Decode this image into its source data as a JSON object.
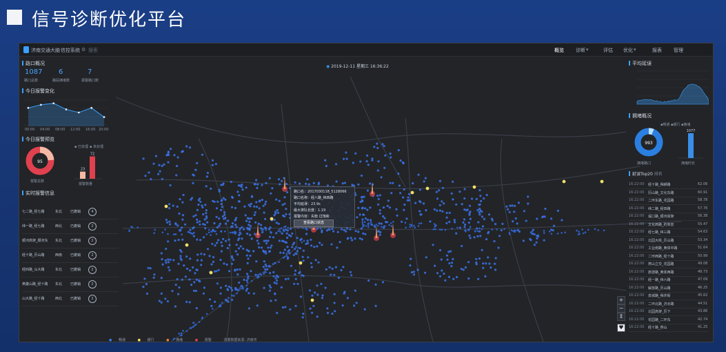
{
  "slide": {
    "title": "信号诊断优化平台"
  },
  "app": {
    "brand": "济南交通大脑",
    "subsystem": "信控系统",
    "search_placeholder": "搜索",
    "nav": [
      "概览",
      "诊断",
      "评估",
      "优化",
      "报表",
      "管理"
    ],
    "datetime": "2019-12-11 星期三 16:36:22"
  },
  "left": {
    "crossing_overview": {
      "title": "路口概况",
      "stats": [
        {
          "value": "1087",
          "label": "路口总数"
        },
        {
          "value": "6",
          "label": "路段拥堵数"
        },
        {
          "value": "7",
          "label": "报警路口数"
        }
      ]
    },
    "alarm_change": {
      "title": "今日报警变化",
      "values": [
        12,
        14,
        15,
        11,
        9,
        12,
        6
      ],
      "xlabels": [
        "00:00",
        "04:00",
        "08:00",
        "12:00",
        "16:00",
        "20:00"
      ]
    },
    "alarm_preview": {
      "title": "今日报警预览",
      "donut_label": "报警总数",
      "donut_value": "95",
      "bar_legend": [
        "已处理",
        "未处理"
      ],
      "bar_values": [
        23,
        72
      ],
      "bar_caption": "报警数量"
    },
    "alarm_info": {
      "title": "实时报警信息",
      "rows": [
        {
          "name": "七二路_经七路",
          "dir": "东北",
          "status": "已撤销",
          "n": "4"
        },
        {
          "name": "纬一路_经七路",
          "dir": "西北",
          "status": "已撤销",
          "n": "2"
        },
        {
          "name": "顺河高架_顺河东",
          "dir": "东北",
          "status": "已撤销",
          "n": "2"
        },
        {
          "name": "经十路_历山路",
          "dir": "西南",
          "status": "已撤销",
          "n": "2"
        },
        {
          "name": "经四路_山大路",
          "dir": "东北",
          "status": "已撤销",
          "n": "2"
        },
        {
          "name": "英雄山路_经十路",
          "dir": "东北",
          "status": "已撤销",
          "n": "2"
        },
        {
          "name": "山大路_经十路",
          "dir": "西北",
          "status": "已撤销",
          "n": "2"
        }
      ]
    }
  },
  "popup": {
    "lines": [
      "路口名：2017030118_5128066",
      "路口名称：经八路_纬四路",
      "平均延误：23.9s",
      "最大排队长度：1.19",
      "报警内容：失衡 过饱和"
    ],
    "button": "查看路口状态"
  },
  "right": {
    "avg_delay": {
      "title": "平均延误"
    },
    "congestion": {
      "title": "拥堵概况",
      "legend": [
        "畅通",
        "缓行",
        "拥堵"
      ],
      "donut_value": "993",
      "donut_caption": "拥堵路口",
      "bar_value": "1077",
      "bar_caption": "拥堵时长"
    },
    "ranking": {
      "title": "延误Top20",
      "subtitle": "排名",
      "rows": [
        {
          "t": "16:22:00",
          "name": "经十路_舜耕路",
          "v": "62.06"
        },
        {
          "t": "16:22:00",
          "name": "历山路_文化东路",
          "v": "60.91"
        },
        {
          "t": "16:22:00",
          "name": "二环东路_花园路",
          "v": "58.78"
        },
        {
          "t": "16:22:00",
          "name": "纬二路_经四路",
          "v": "57.76"
        },
        {
          "t": "16:22:00",
          "name": "堤口路_顺河高架",
          "v": "56.38"
        },
        {
          "t": "16:22:00",
          "name": "文化西路_趵突泉",
          "v": "55.47"
        },
        {
          "t": "16:22:00",
          "name": "经七路_纬三路",
          "v": "54.63"
        },
        {
          "t": "16:22:00",
          "name": "北园大街_历山路",
          "v": "53.34"
        },
        {
          "t": "16:22:00",
          "name": "工业南路_奥体中路",
          "v": "51.64"
        },
        {
          "t": "16:22:00",
          "name": "二环西路_经十路",
          "v": "50.99"
        },
        {
          "t": "16:22:00",
          "name": "燕山立交_花园路",
          "v": "49.08"
        },
        {
          "t": "16:22:00",
          "name": "旅游路_奥体西路",
          "v": "48.73"
        },
        {
          "t": "16:22:00",
          "name": "经一路_纬六路",
          "v": "47.09"
        },
        {
          "t": "16:22:00",
          "name": "解放路_历山路",
          "v": "46.25"
        },
        {
          "t": "16:22:00",
          "name": "泉城路_舜井街",
          "v": "45.62"
        },
        {
          "t": "16:22:00",
          "name": "二环北路_济泺路",
          "v": "44.51"
        },
        {
          "t": "16:22:00",
          "name": "北园高架_历下",
          "v": "43.86"
        },
        {
          "t": "16:22:00",
          "name": "花园路_二环东",
          "v": "42.74"
        },
        {
          "t": "16:22:00",
          "name": "经十路_燕山",
          "v": "41.25"
        }
      ]
    }
  },
  "legend": {
    "items": [
      "畅通",
      "缓行",
      "拥堵",
      "报警"
    ],
    "note": "流量数据来源: 济南市"
  },
  "colors": {
    "accent": "#3aa1ff",
    "alarm": "#e0414f",
    "warn": "#f0e06a"
  }
}
